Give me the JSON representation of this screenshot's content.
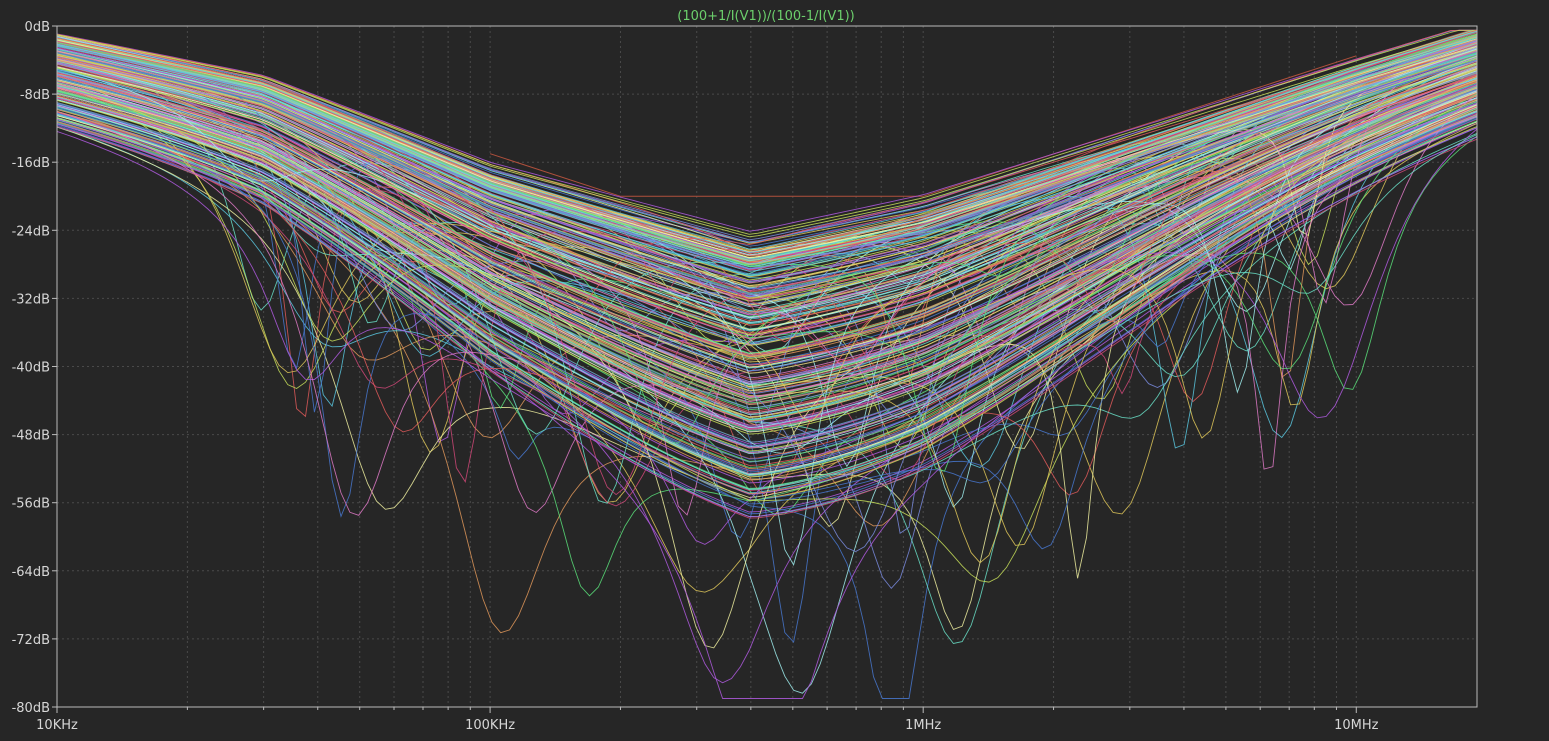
{
  "chart_data": {
    "type": "line",
    "title": "(100+1/I(V1))/(100-1/I(V1))",
    "x_scale": "log",
    "xlim": [
      10000,
      19000000
    ],
    "ylim": [
      -80,
      0
    ],
    "x_ticks": [
      {
        "value": 10000,
        "label": "10KHz"
      },
      {
        "value": 100000,
        "label": "100KHz"
      },
      {
        "value": 1000000,
        "label": "1MHz"
      },
      {
        "value": 10000000,
        "label": "10MHz"
      }
    ],
    "y_ticks": [
      {
        "value": 0,
        "label": "0dB"
      },
      {
        "value": -8,
        "label": "-8dB"
      },
      {
        "value": -16,
        "label": "-16dB"
      },
      {
        "value": -24,
        "label": "-24dB"
      },
      {
        "value": -32,
        "label": "-32dB"
      },
      {
        "value": -40,
        "label": "-40dB"
      },
      {
        "value": -48,
        "label": "-48dB"
      },
      {
        "value": -56,
        "label": "-56dB"
      },
      {
        "value": -64,
        "label": "-64dB"
      },
      {
        "value": -72,
        "label": "-72dB"
      },
      {
        "value": -80,
        "label": "-80dB"
      }
    ],
    "grid": true,
    "mask": {
      "color": "#b0503c",
      "points": [
        [
          100000,
          -15
        ],
        [
          200000,
          -20
        ],
        [
          1000000,
          -20
        ],
        [
          10000000,
          -3.5
        ]
      ]
    },
    "sweep": {
      "count": 320,
      "envelope_top": [
        [
          10000,
          -0.8
        ],
        [
          30000,
          -6
        ],
        [
          100000,
          -16.5
        ],
        [
          400000,
          -25
        ],
        [
          1000000,
          -21
        ],
        [
          10000000,
          -6
        ],
        [
          19000000,
          -2
        ]
      ],
      "colors": [
        "#e05a5a",
        "#5ac8e0",
        "#e0c85a",
        "#b05ae0",
        "#5ae07a",
        "#e07ac8",
        "#7a8ce0",
        "#e0985a",
        "#6ae0c8",
        "#c8e05a",
        "#d04878",
        "#4878d0",
        "#f0f0a0",
        "#a0f0f0"
      ]
    }
  },
  "colors": {
    "background": "#262626",
    "grid": "#4a4a4a",
    "axis": "#bbbbbb",
    "tick_text": "#d6d6d6",
    "title": "#6ccf6c"
  }
}
